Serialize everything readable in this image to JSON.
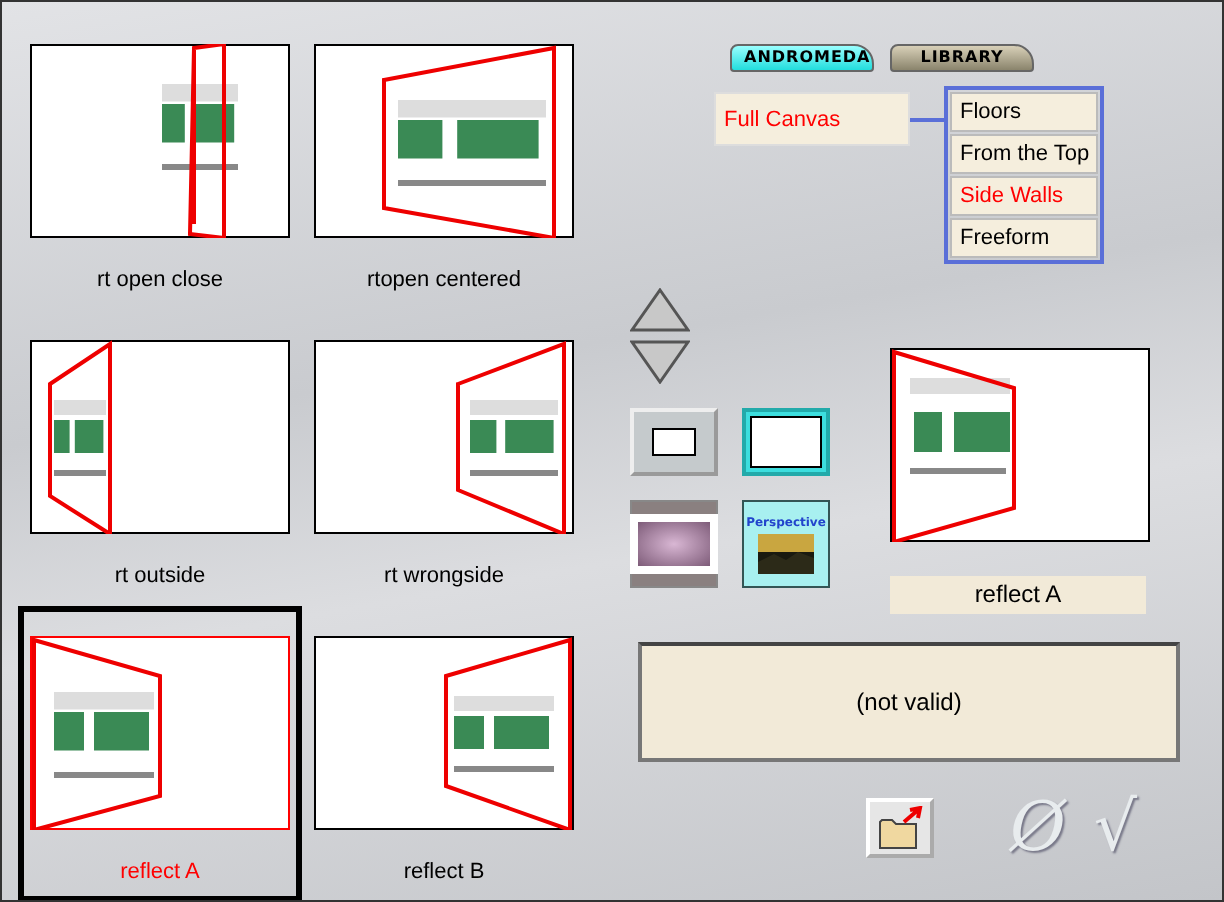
{
  "thumbnails": [
    {
      "label": "rt open close",
      "selected": false
    },
    {
      "label": "rtopen centered",
      "selected": false
    },
    {
      "label": "rt outside",
      "selected": false
    },
    {
      "label": "rt wrongside",
      "selected": false
    },
    {
      "label": "reflect A",
      "selected": true
    },
    {
      "label": "reflect B",
      "selected": false
    }
  ],
  "tabs": [
    {
      "label": "ANDROMEDA",
      "selected": true
    },
    {
      "label": "LIBRARY",
      "selected": false
    }
  ],
  "mode": {
    "label": "Full Canvas",
    "selected": true
  },
  "options": [
    {
      "label": "Floors",
      "selected": false
    },
    {
      "label": "From the Top",
      "selected": false
    },
    {
      "label": "Side Walls",
      "selected": true
    },
    {
      "label": "Freeform",
      "selected": false
    }
  ],
  "shape_buttons": [
    {
      "kind": "small-frame",
      "selected": false
    },
    {
      "kind": "full-frame",
      "selected": true
    }
  ],
  "image_buttons": [
    {
      "kind": "blur"
    },
    {
      "kind": "perspective",
      "label": "Perspective"
    }
  ],
  "preview_label": "reflect A",
  "status": "(not valid)",
  "actions": [
    {
      "kind": "folder"
    },
    {
      "kind": "cancel",
      "label": "Ø"
    },
    {
      "kind": "accept",
      "label": "√"
    }
  ]
}
